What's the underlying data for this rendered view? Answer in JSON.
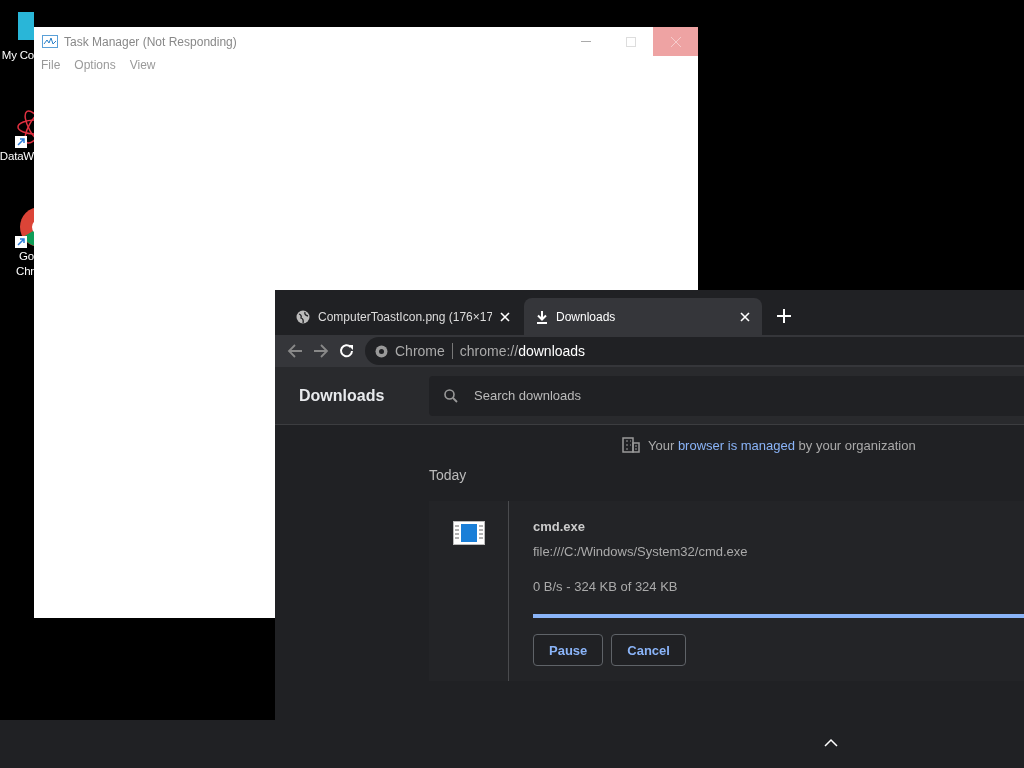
{
  "desktop_icons": [
    {
      "kind": "monitor",
      "lines": [
        "My Co"
      ]
    },
    {
      "kind": "atom",
      "lines": [
        "DataW"
      ]
    },
    {
      "kind": "chrome",
      "lines": [
        "Go",
        "Chr"
      ]
    }
  ],
  "task_manager": {
    "title": "Task Manager (Not Responding)",
    "menu": [
      "File",
      "Options",
      "View"
    ]
  },
  "browser": {
    "tabs": [
      {
        "label": "ComputerToastIcon.png (176×17",
        "kind": "globe",
        "selected": false
      },
      {
        "label": "Downloads",
        "kind": "download",
        "selected": true
      }
    ],
    "omnibox": {
      "site": "Chrome",
      "url_prefix": "chrome://",
      "url_host": "downloads"
    },
    "page_title": "Downloads",
    "search": {
      "placeholder": "Search downloads"
    },
    "managed_notice": {
      "before": "Your ",
      "link": "browser is managed",
      "after": " by your organization"
    },
    "section": "Today",
    "download": {
      "name": "cmd.exe",
      "url": "file:///C:/Windows/System32/cmd.exe",
      "status": "0 B/s - 324 KB of 324 KB",
      "level": 1,
      "buttons": [
        "Pause",
        "Cancel"
      ]
    }
  }
}
